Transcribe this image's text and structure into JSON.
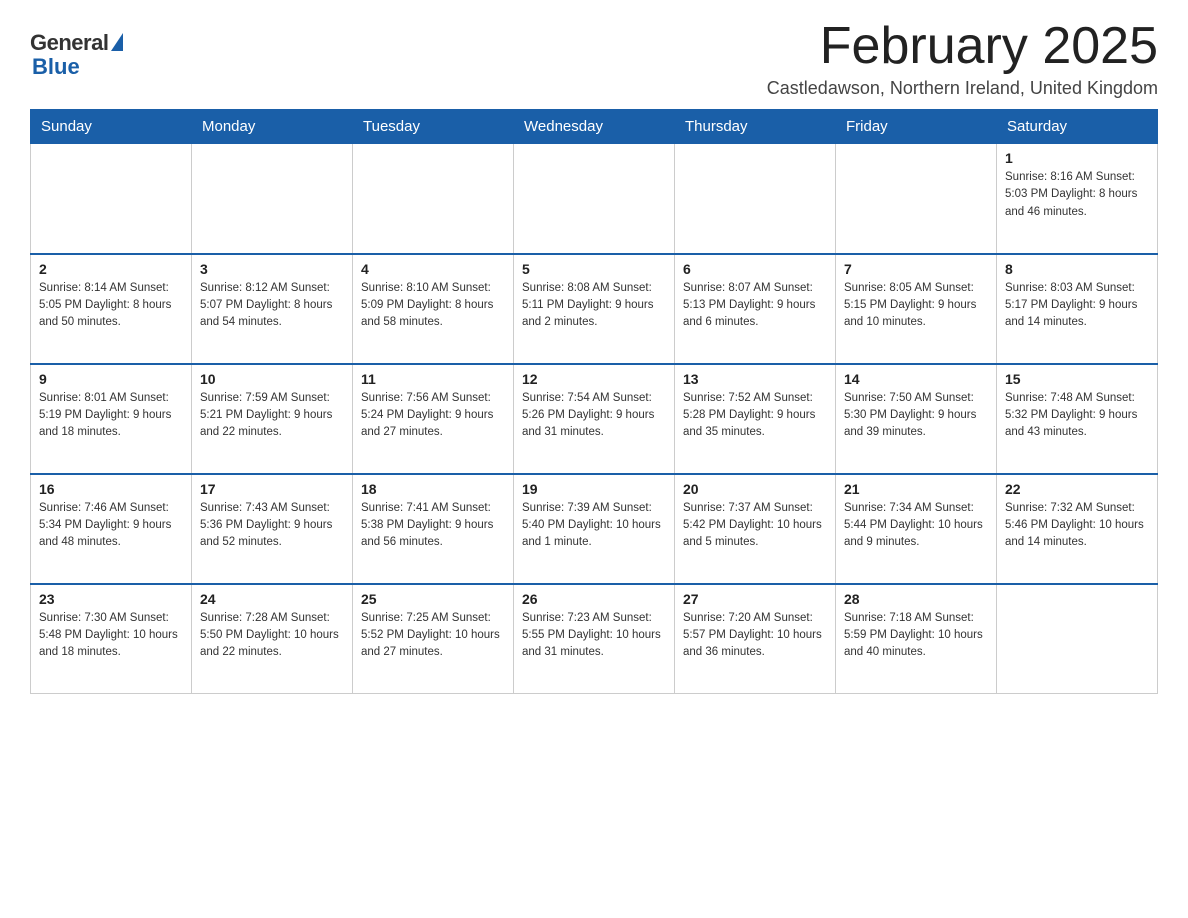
{
  "logo": {
    "general": "General",
    "blue": "Blue"
  },
  "header": {
    "title": "February 2025",
    "location": "Castledawson, Northern Ireland, United Kingdom"
  },
  "days_of_week": [
    "Sunday",
    "Monday",
    "Tuesday",
    "Wednesday",
    "Thursday",
    "Friday",
    "Saturday"
  ],
  "weeks": [
    [
      {
        "day": "",
        "info": ""
      },
      {
        "day": "",
        "info": ""
      },
      {
        "day": "",
        "info": ""
      },
      {
        "day": "",
        "info": ""
      },
      {
        "day": "",
        "info": ""
      },
      {
        "day": "",
        "info": ""
      },
      {
        "day": "1",
        "info": "Sunrise: 8:16 AM\nSunset: 5:03 PM\nDaylight: 8 hours and 46 minutes."
      }
    ],
    [
      {
        "day": "2",
        "info": "Sunrise: 8:14 AM\nSunset: 5:05 PM\nDaylight: 8 hours and 50 minutes."
      },
      {
        "day": "3",
        "info": "Sunrise: 8:12 AM\nSunset: 5:07 PM\nDaylight: 8 hours and 54 minutes."
      },
      {
        "day": "4",
        "info": "Sunrise: 8:10 AM\nSunset: 5:09 PM\nDaylight: 8 hours and 58 minutes."
      },
      {
        "day": "5",
        "info": "Sunrise: 8:08 AM\nSunset: 5:11 PM\nDaylight: 9 hours and 2 minutes."
      },
      {
        "day": "6",
        "info": "Sunrise: 8:07 AM\nSunset: 5:13 PM\nDaylight: 9 hours and 6 minutes."
      },
      {
        "day": "7",
        "info": "Sunrise: 8:05 AM\nSunset: 5:15 PM\nDaylight: 9 hours and 10 minutes."
      },
      {
        "day": "8",
        "info": "Sunrise: 8:03 AM\nSunset: 5:17 PM\nDaylight: 9 hours and 14 minutes."
      }
    ],
    [
      {
        "day": "9",
        "info": "Sunrise: 8:01 AM\nSunset: 5:19 PM\nDaylight: 9 hours and 18 minutes."
      },
      {
        "day": "10",
        "info": "Sunrise: 7:59 AM\nSunset: 5:21 PM\nDaylight: 9 hours and 22 minutes."
      },
      {
        "day": "11",
        "info": "Sunrise: 7:56 AM\nSunset: 5:24 PM\nDaylight: 9 hours and 27 minutes."
      },
      {
        "day": "12",
        "info": "Sunrise: 7:54 AM\nSunset: 5:26 PM\nDaylight: 9 hours and 31 minutes."
      },
      {
        "day": "13",
        "info": "Sunrise: 7:52 AM\nSunset: 5:28 PM\nDaylight: 9 hours and 35 minutes."
      },
      {
        "day": "14",
        "info": "Sunrise: 7:50 AM\nSunset: 5:30 PM\nDaylight: 9 hours and 39 minutes."
      },
      {
        "day": "15",
        "info": "Sunrise: 7:48 AM\nSunset: 5:32 PM\nDaylight: 9 hours and 43 minutes."
      }
    ],
    [
      {
        "day": "16",
        "info": "Sunrise: 7:46 AM\nSunset: 5:34 PM\nDaylight: 9 hours and 48 minutes."
      },
      {
        "day": "17",
        "info": "Sunrise: 7:43 AM\nSunset: 5:36 PM\nDaylight: 9 hours and 52 minutes."
      },
      {
        "day": "18",
        "info": "Sunrise: 7:41 AM\nSunset: 5:38 PM\nDaylight: 9 hours and 56 minutes."
      },
      {
        "day": "19",
        "info": "Sunrise: 7:39 AM\nSunset: 5:40 PM\nDaylight: 10 hours and 1 minute."
      },
      {
        "day": "20",
        "info": "Sunrise: 7:37 AM\nSunset: 5:42 PM\nDaylight: 10 hours and 5 minutes."
      },
      {
        "day": "21",
        "info": "Sunrise: 7:34 AM\nSunset: 5:44 PM\nDaylight: 10 hours and 9 minutes."
      },
      {
        "day": "22",
        "info": "Sunrise: 7:32 AM\nSunset: 5:46 PM\nDaylight: 10 hours and 14 minutes."
      }
    ],
    [
      {
        "day": "23",
        "info": "Sunrise: 7:30 AM\nSunset: 5:48 PM\nDaylight: 10 hours and 18 minutes."
      },
      {
        "day": "24",
        "info": "Sunrise: 7:28 AM\nSunset: 5:50 PM\nDaylight: 10 hours and 22 minutes."
      },
      {
        "day": "25",
        "info": "Sunrise: 7:25 AM\nSunset: 5:52 PM\nDaylight: 10 hours and 27 minutes."
      },
      {
        "day": "26",
        "info": "Sunrise: 7:23 AM\nSunset: 5:55 PM\nDaylight: 10 hours and 31 minutes."
      },
      {
        "day": "27",
        "info": "Sunrise: 7:20 AM\nSunset: 5:57 PM\nDaylight: 10 hours and 36 minutes."
      },
      {
        "day": "28",
        "info": "Sunrise: 7:18 AM\nSunset: 5:59 PM\nDaylight: 10 hours and 40 minutes."
      },
      {
        "day": "",
        "info": ""
      }
    ]
  ]
}
